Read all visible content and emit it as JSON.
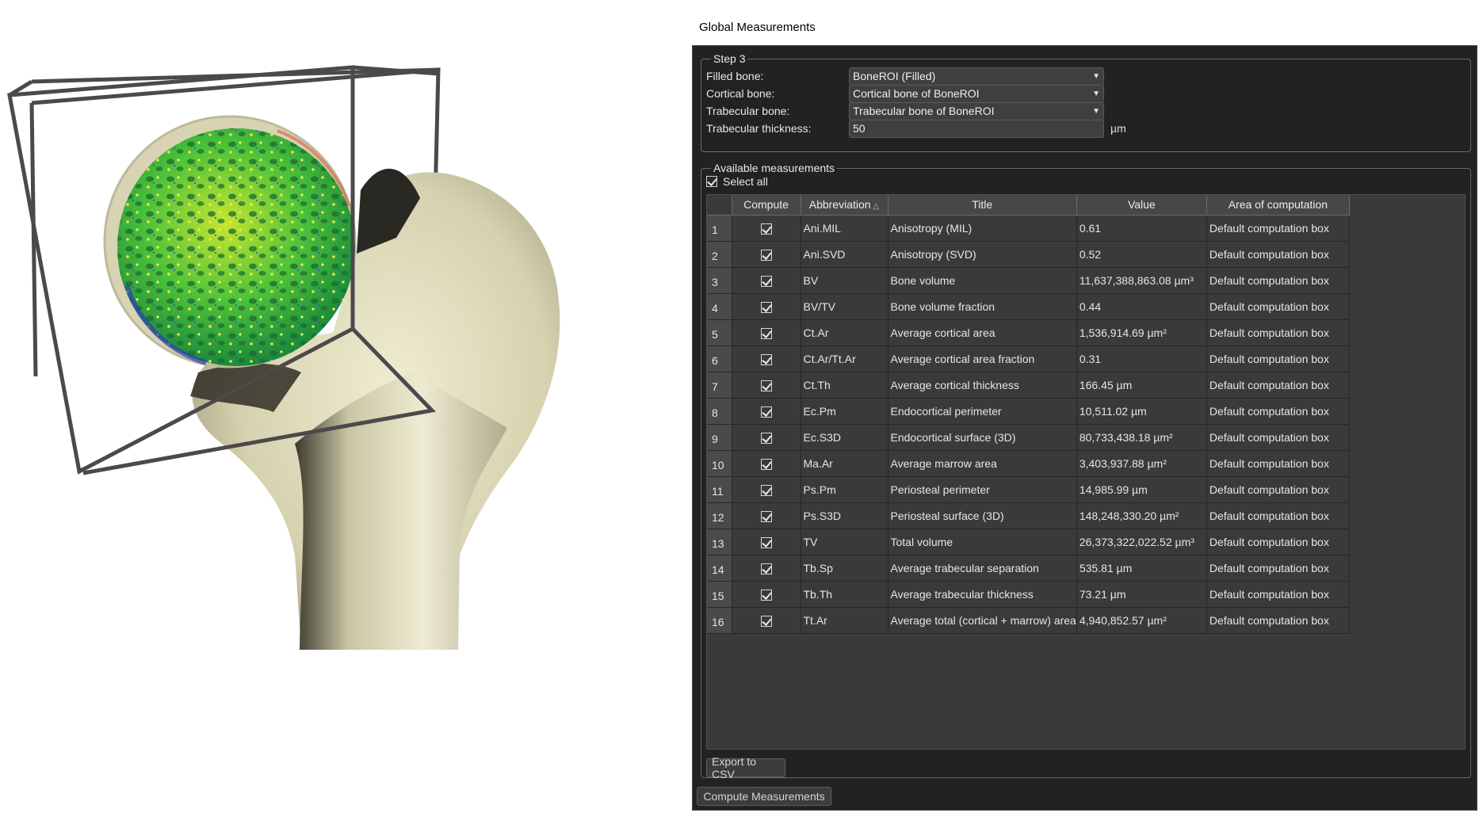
{
  "panel": {
    "title": "Global Measurements",
    "step": {
      "legend": "Step 3",
      "filled_bone_label": "Filled bone:",
      "filled_bone_value": "BoneROI (Filled)",
      "cortical_bone_label": "Cortical bone:",
      "cortical_bone_value": "Cortical bone of BoneROI",
      "trabecular_bone_label": "Trabecular bone:",
      "trabecular_bone_value": "Trabecular bone of BoneROI",
      "trabecular_thickness_label": "Trabecular thickness:",
      "trabecular_thickness_value": "50",
      "trabecular_thickness_unit": "µm"
    },
    "available": {
      "legend": "Available measurements",
      "select_all_label": "Select all",
      "select_all_checked": true,
      "columns": [
        "Compute",
        "Abbreviation",
        "Title",
        "Value",
        "Area of computation"
      ],
      "sorted_column": "Abbreviation",
      "rows": [
        {
          "num": "1",
          "compute": true,
          "abbr": "Ani.MIL",
          "title": "Anisotropy (MIL)",
          "value": "0.61",
          "area": "Default computation box"
        },
        {
          "num": "2",
          "compute": true,
          "abbr": "Ani.SVD",
          "title": "Anisotropy (SVD)",
          "value": "0.52",
          "area": "Default computation box"
        },
        {
          "num": "3",
          "compute": true,
          "abbr": "BV",
          "title": "Bone volume",
          "value": "11,637,388,863.08 µm³",
          "area": "Default computation box"
        },
        {
          "num": "4",
          "compute": true,
          "abbr": "BV/TV",
          "title": "Bone volume fraction",
          "value": "0.44",
          "area": "Default computation box"
        },
        {
          "num": "5",
          "compute": true,
          "abbr": "Ct.Ar",
          "title": "Average cortical area",
          "value": "1,536,914.69 µm²",
          "area": "Default computation box"
        },
        {
          "num": "6",
          "compute": true,
          "abbr": "Ct.Ar/Tt.Ar",
          "title": "Average cortical area fraction",
          "value": "0.31",
          "area": "Default computation box"
        },
        {
          "num": "7",
          "compute": true,
          "abbr": "Ct.Th",
          "title": "Average cortical thickness",
          "value": "166.45 µm",
          "area": "Default computation box"
        },
        {
          "num": "8",
          "compute": true,
          "abbr": "Ec.Pm",
          "title": "Endocortical perimeter",
          "value": "10,511.02 µm",
          "area": "Default computation box"
        },
        {
          "num": "9",
          "compute": true,
          "abbr": "Ec.S3D",
          "title": "Endocortical surface (3D)",
          "value": "80,733,438.18 µm²",
          "area": "Default computation box"
        },
        {
          "num": "10",
          "compute": true,
          "abbr": "Ma.Ar",
          "title": "Average marrow area",
          "value": "3,403,937.88 µm²",
          "area": "Default computation box"
        },
        {
          "num": "11",
          "compute": true,
          "abbr": "Ps.Pm",
          "title": "Periosteal perimeter",
          "value": "14,985.99 µm",
          "area": "Default computation box"
        },
        {
          "num": "12",
          "compute": true,
          "abbr": "Ps.S3D",
          "title": "Periosteal surface (3D)",
          "value": "148,248,330.20 µm²",
          "area": "Default computation box"
        },
        {
          "num": "13",
          "compute": true,
          "abbr": "TV",
          "title": "Total volume",
          "value": "26,373,322,022.52 µm³",
          "area": "Default computation box"
        },
        {
          "num": "14",
          "compute": true,
          "abbr": "Tb.Sp",
          "title": "Average trabecular separation",
          "value": "535.81 µm",
          "area": "Default computation box"
        },
        {
          "num": "15",
          "compute": true,
          "abbr": "Tb.Th",
          "title": "Average trabecular thickness",
          "value": "73.21 µm",
          "area": "Default computation box"
        },
        {
          "num": "16",
          "compute": true,
          "abbr": "Tt.Ar",
          "title": "Average total (cortical + marrow) area",
          "value": "4,940,852.57 µm²",
          "area": "Default computation box"
        }
      ],
      "export_label": "Export to CSV"
    },
    "compute_label": "Compute Measurements"
  },
  "colors": {
    "panel_bg": "#222222",
    "bone": "#d9d6b6",
    "box_frame": "#4a4a4a"
  },
  "icons": {
    "dropdown": "chevron-down-icon",
    "checkbox": "checkmark-icon",
    "sort": "sort-ascending-icon"
  }
}
